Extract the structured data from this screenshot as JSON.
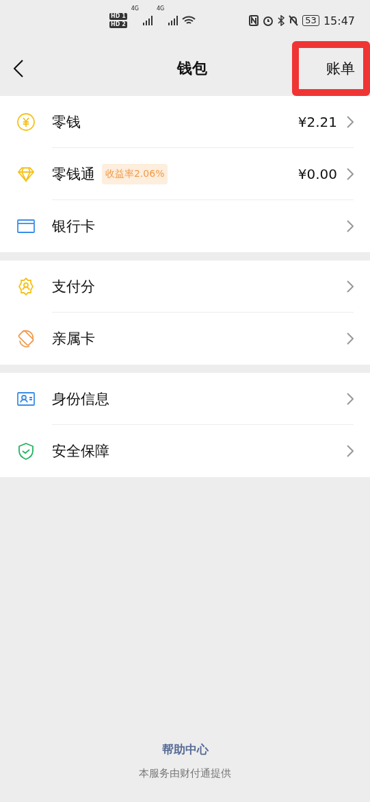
{
  "status_bar": {
    "sims": [
      {
        "label": "HD",
        "slot": "1"
      },
      {
        "label": "HD",
        "slot": "2"
      }
    ],
    "networks": [
      "4G",
      "4G"
    ],
    "battery": "53",
    "time": "15:47"
  },
  "nav": {
    "title": "钱包",
    "action": {
      "label": "账单",
      "highlighted": true
    }
  },
  "groups": [
    {
      "items": [
        {
          "kind": "coin",
          "label": "零钱",
          "value": "¥2.21"
        },
        {
          "kind": "diamond",
          "label": "零钱通",
          "badge": "收益率2.06%",
          "value": "¥0.00"
        },
        {
          "kind": "card",
          "label": "银行卡"
        }
      ]
    },
    {
      "items": [
        {
          "kind": "score",
          "label": "支付分"
        },
        {
          "kind": "family",
          "label": "亲属卡"
        }
      ]
    },
    {
      "items": [
        {
          "kind": "id",
          "label": "身份信息"
        },
        {
          "kind": "shield",
          "label": "安全保障"
        }
      ]
    }
  ],
  "footer": {
    "link": "帮助中心",
    "note": "本服务由财付通提供"
  }
}
